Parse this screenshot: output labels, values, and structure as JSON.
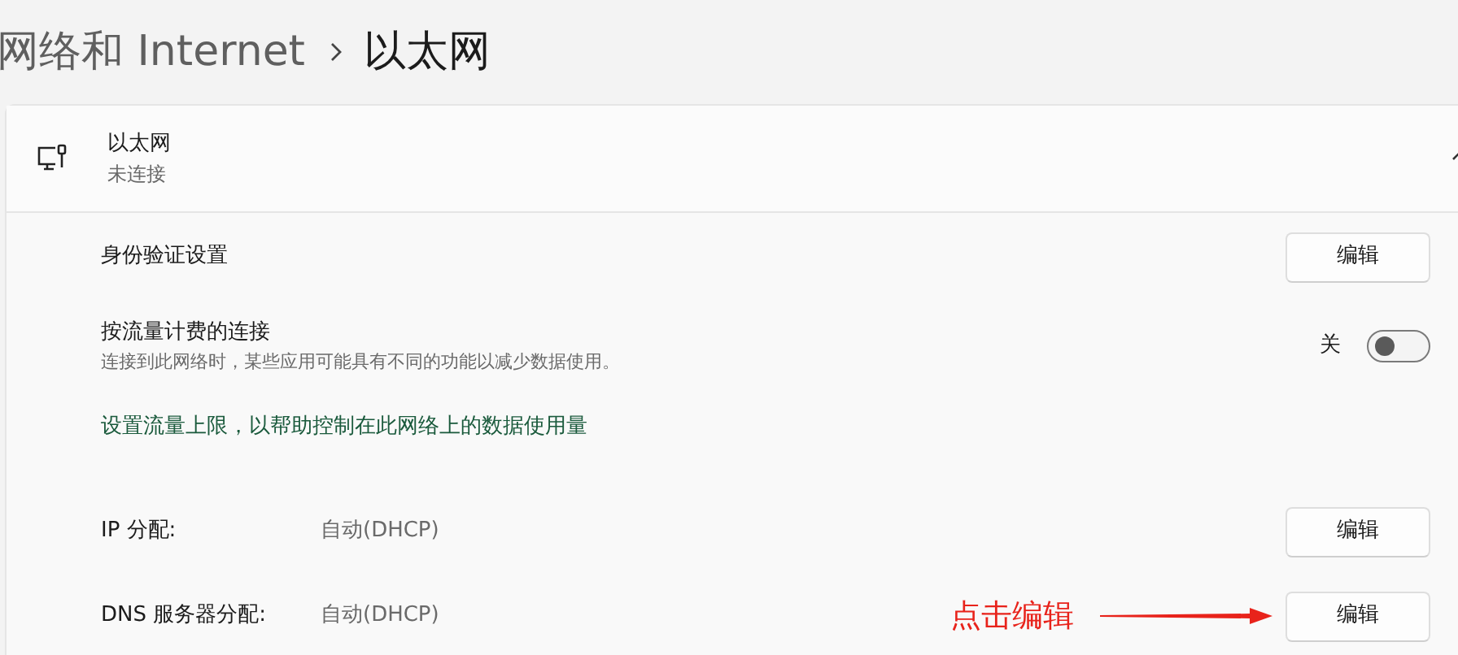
{
  "breadcrumb": {
    "parent": "网络和 Internet",
    "current": "以太网"
  },
  "adapter": {
    "title": "以太网",
    "subtitle": "未连接",
    "expanded": true
  },
  "settings": [
    {
      "kind": "button",
      "label": "身份验证设置",
      "button": "编辑"
    },
    {
      "kind": "toggle",
      "label": "按流量计费的连接",
      "description": "连接到此网络时，某些应用可能具有不同的功能以减少数据使用。",
      "state_label": "关",
      "on": false
    },
    {
      "kind": "link",
      "label": "设置流量上限，以帮助控制在此网络上的数据使用量"
    },
    {
      "kind": "value",
      "label": "IP 分配:",
      "value": "自动(DHCP)",
      "button": "编辑"
    },
    {
      "kind": "value",
      "label": "DNS 服务器分配:",
      "value": "自动(DHCP)",
      "button": "编辑",
      "annotation": "点击编辑"
    }
  ]
}
